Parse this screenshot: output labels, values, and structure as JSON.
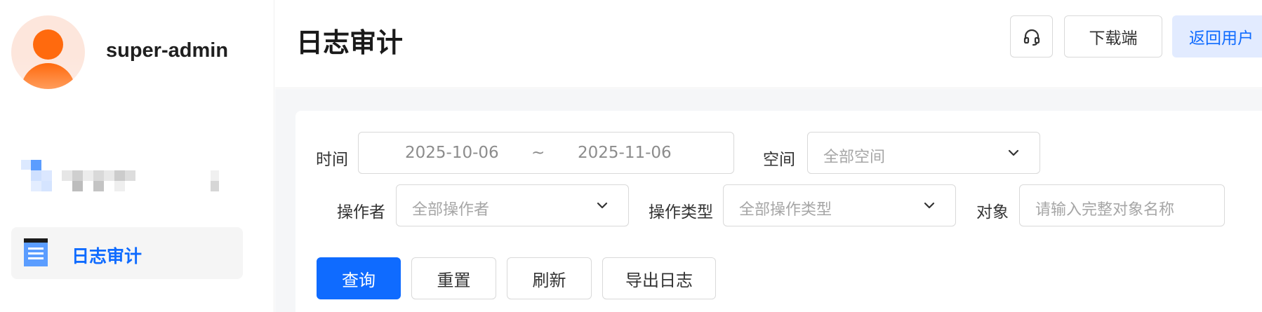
{
  "user": {
    "name": "super-admin"
  },
  "sidebar": {
    "items": [
      {
        "label": "日志审计",
        "icon": "document-list-icon",
        "active": true
      }
    ]
  },
  "header": {
    "title": "日志审计",
    "support_icon": "headset-icon",
    "download_label": "下载端",
    "return_label": "返回用户"
  },
  "filters": {
    "time": {
      "label": "时间",
      "start": "2025-10-06",
      "separator": "~",
      "end": "2025-11-06"
    },
    "space": {
      "label": "空间",
      "placeholder": "全部空间"
    },
    "operator": {
      "label": "操作者",
      "placeholder": "全部操作者"
    },
    "op_type": {
      "label": "操作类型",
      "placeholder": "全部操作类型"
    },
    "object": {
      "label": "对象",
      "placeholder": "请输入完整对象名称"
    }
  },
  "actions": {
    "query": "查询",
    "reset": "重置",
    "refresh": "刷新",
    "export": "导出日志"
  },
  "colors": {
    "primary": "#0f6bff",
    "avatar": "#ff6a0e",
    "return_bg": "#e2ebff"
  }
}
